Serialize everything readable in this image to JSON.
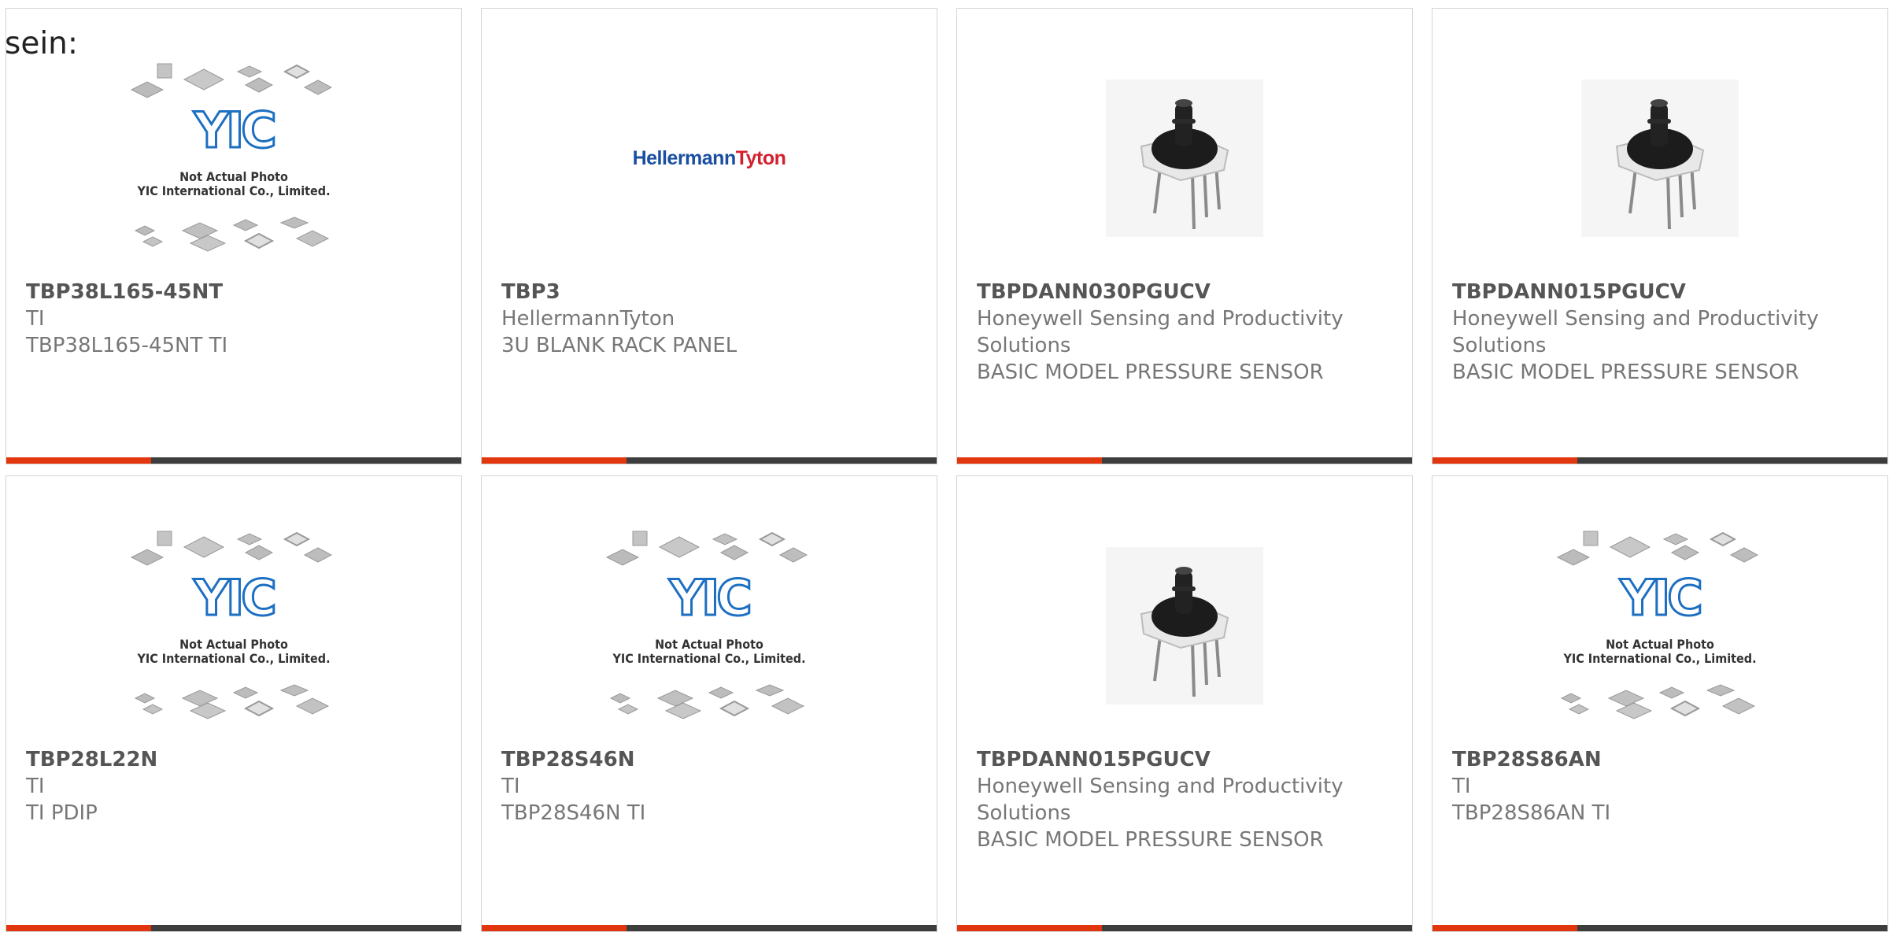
{
  "prefix_text": "sein:",
  "placeholder": {
    "logo_text": "YIC",
    "line1": "Not Actual Photo",
    "line2": "YIC International Co., Limited."
  },
  "brand_logo": {
    "part1": "Hellermann",
    "part2": "Tyton"
  },
  "colors": {
    "accent": "#e2360e",
    "bar": "#3d3d3d",
    "brand_blue": "#1a4ea0",
    "brand_red": "#d3202f",
    "logo_blue": "#1d6fc2"
  },
  "products": [
    {
      "part_no": "TBP38L165-45NT",
      "manufacturer": "TI",
      "description": "TBP38L165-45NT TI",
      "image": "yic-placeholder"
    },
    {
      "part_no": "TBP3",
      "manufacturer": "HellermannTyton",
      "description": "3U BLANK RACK PANEL",
      "image": "brand-logo"
    },
    {
      "part_no": "TBPDANN030PGUCV",
      "manufacturer": "Honeywell Sensing and Productivity Solutions",
      "description": "BASIC MODEL PRESSURE SENSOR",
      "image": "pressure-sensor"
    },
    {
      "part_no": "TBPDANN015PGUCV",
      "manufacturer": "Honeywell Sensing and Productivity Solutions",
      "description": "BASIC MODEL PRESSURE SENSOR",
      "image": "pressure-sensor"
    },
    {
      "part_no": "TBP28L22N",
      "manufacturer": "TI",
      "description": "TI PDIP",
      "image": "yic-placeholder"
    },
    {
      "part_no": "TBP28S46N",
      "manufacturer": "TI",
      "description": "TBP28S46N TI",
      "image": "yic-placeholder"
    },
    {
      "part_no": "TBPDANN015PGUCV",
      "manufacturer": "Honeywell Sensing and Productivity Solutions",
      "description": "BASIC MODEL PRESSURE SENSOR",
      "image": "pressure-sensor"
    },
    {
      "part_no": "TBP28S86AN",
      "manufacturer": "TI",
      "description": "TBP28S86AN TI",
      "image": "yic-placeholder"
    }
  ]
}
